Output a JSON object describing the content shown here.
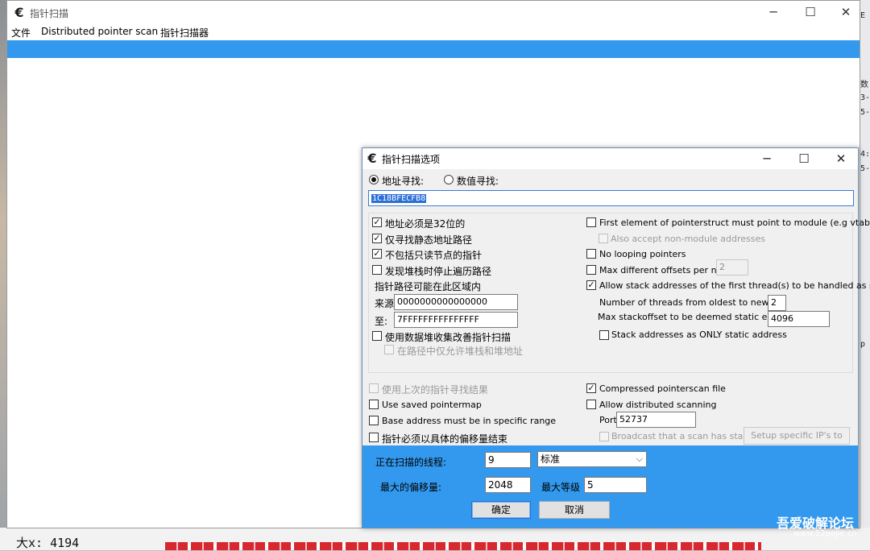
{
  "main_window": {
    "title": "指针扫描",
    "menu": [
      "文件",
      "Distributed pointer scan",
      "指针扫描器"
    ]
  },
  "background": {
    "bottom_text": "大x: 4194",
    "right_text": [
      "E",
      "数",
      "3-",
      "5-",
      "4:",
      "5-",
      "p"
    ]
  },
  "dialog": {
    "title": "指针扫描选项",
    "radio_address": "地址寻找:",
    "radio_value": "数值寻找:",
    "address_value": "1C18BFECFB8",
    "left_options": [
      {
        "label": "地址必须是32位的",
        "checked": true
      },
      {
        "label": "仅寻找静态地址路径",
        "checked": true
      },
      {
        "label": "不包括只读节点的指针",
        "checked": true
      },
      {
        "label": "发现堆栈时停止遍历路径",
        "checked": false
      }
    ],
    "range_label": "指针路径可能在此区域内",
    "from_label": "来源",
    "from_value": "0000000000000000",
    "to_label": "至:",
    "to_value": "7FFFFFFFFFFFFFFF",
    "heap_option": "使用数据堆收集改善指针扫描",
    "heap_sub_option": "在路径中仅允许堆栈和堆地址",
    "right_options": {
      "first_element": "First element of pointerstruct must point to module (e.g vtable)",
      "non_module": "Also accept non-module addresses",
      "no_looping": "No looping pointers",
      "max_offsets": "Max different offsets per node:",
      "max_offsets_value": "2",
      "allow_stack": "Allow stack addresses of the first thread(s) to be handled as static",
      "threads_label": "Number of threads from oldest to newest:",
      "threads_value": "2",
      "stackoffset_label": "Max stackoffset to be deemed static enough:",
      "stackoffset_value": "4096",
      "stack_only": "Stack addresses as ONLY static address"
    },
    "bottom_left": [
      {
        "label": "使用上次的指针寻找结果",
        "checked": false,
        "disabled": true
      },
      {
        "label": "Use saved pointermap",
        "checked": false,
        "disabled": false
      },
      {
        "label": "Base address must be in specific range",
        "checked": false,
        "disabled": false
      },
      {
        "label": "指针必须以具体的偏移量结束",
        "checked": false,
        "disabled": false
      }
    ],
    "compressed": "Compressed pointerscan file",
    "distributed": "Allow distributed scanning",
    "port_label": "Port:",
    "port_value": "52737",
    "broadcast": "Broadcast that a scan has started",
    "setup_ips": "Setup specific IP's to notify",
    "threads_scanning_label": "正在扫描的线程:",
    "threads_scanning_value": "9",
    "priority_value": "标准",
    "max_offset_label": "最大的偏移量:",
    "max_offset_value": "2048",
    "max_level_label": "最大等级",
    "max_level_value": "5",
    "ok": "确定",
    "cancel": "取消"
  },
  "watermark": {
    "text": "吾爱破解论坛",
    "url": "www.52pojie.cn"
  },
  "colors": {
    "accent_blue": "#3399ee",
    "selection": "#2b6fd6"
  }
}
